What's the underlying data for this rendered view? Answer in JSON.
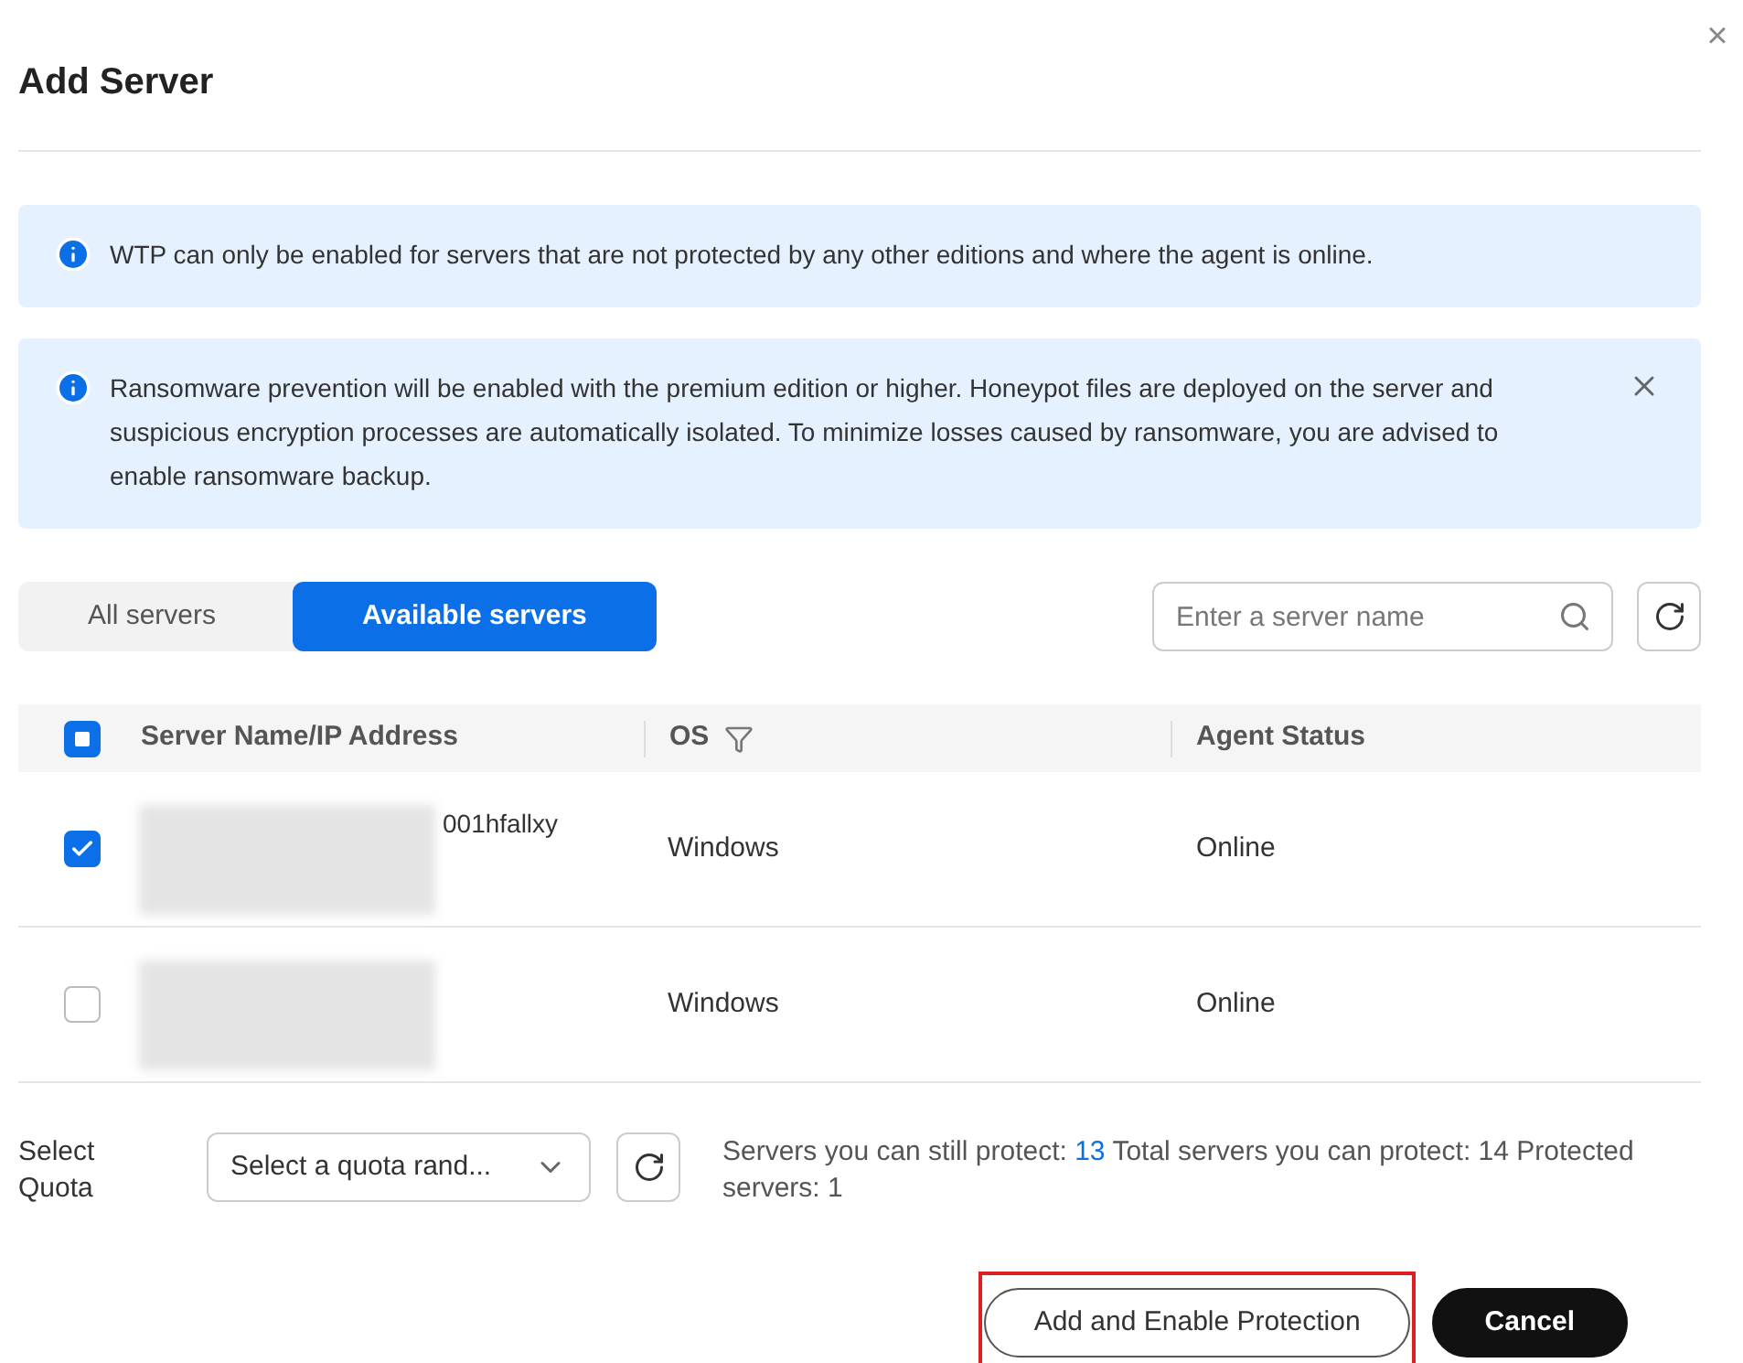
{
  "dialog": {
    "title": "Add Server",
    "close": "×"
  },
  "alerts": [
    {
      "text": "WTP can only be enabled for servers that are not protected by any other editions and where the agent is online.",
      "closable": false
    },
    {
      "text": "Ransomware prevention will be enabled with the premium edition or higher. Honeypot files are deployed on the server and suspicious encryption processes are automatically isolated. To minimize losses caused by ransomware, you are advised to enable ransomware backup.",
      "closable": true
    }
  ],
  "tabs": [
    {
      "label": "All servers",
      "selected": false
    },
    {
      "label": "Available servers",
      "selected": true
    }
  ],
  "search": {
    "placeholder": "Enter a server name"
  },
  "table": {
    "some_checked": true,
    "columns": [
      "Server Name/IP Address",
      "OS",
      "Agent Status"
    ],
    "rows": [
      {
        "name": "001hfallxy",
        "os": "Windows",
        "status": "Online",
        "checked": true
      },
      {
        "os": "Windows",
        "status": "Online",
        "checked": false
      }
    ]
  },
  "quota": {
    "label": "Select Quota",
    "placeholder": "Select a quota rand...",
    "still_label": "Servers you can still protect:",
    "still_count": "13",
    "rest": "Total servers you can protect: 14 Protected servers: 1"
  },
  "buttons": [
    {
      "label": "Add and Enable Protection",
      "kind": "secondary",
      "highlighted": true
    },
    {
      "label": "Cancel",
      "kind": "primary",
      "highlighted": false
    }
  ]
}
